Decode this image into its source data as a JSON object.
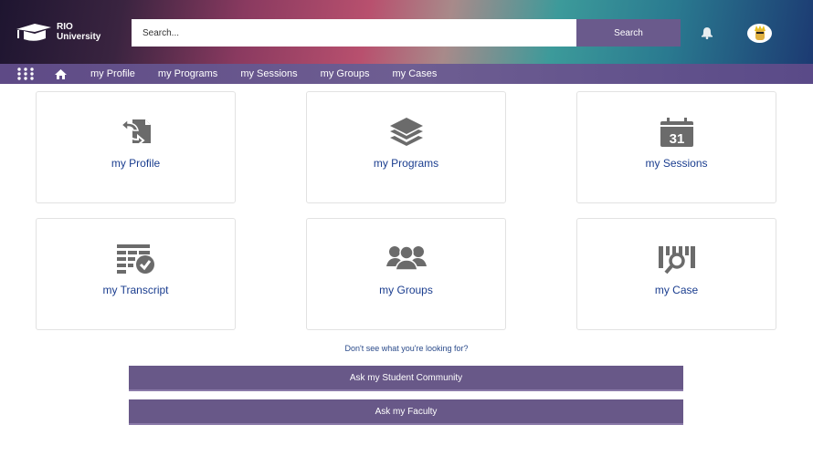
{
  "header": {
    "logo_line1": "RIO",
    "logo_line2": "University",
    "search_placeholder": "Search...",
    "search_button": "Search"
  },
  "nav": {
    "items": [
      "my Profile",
      "my Programs",
      "my Sessions",
      "my Groups",
      "my Cases"
    ]
  },
  "tiles": [
    {
      "label": "my Profile",
      "icon": "profile-swap-icon"
    },
    {
      "label": "my Programs",
      "icon": "layers-icon"
    },
    {
      "label": "my Sessions",
      "icon": "calendar-icon",
      "calendar_day": "31"
    },
    {
      "label": "my Transcript",
      "icon": "transcript-check-icon"
    },
    {
      "label": "my Groups",
      "icon": "groups-icon"
    },
    {
      "label": "my Case",
      "icon": "case-search-icon"
    }
  ],
  "help": {
    "question": "Don't see what you're looking for?",
    "ask_community": "Ask my Student Community",
    "ask_faculty": "Ask my Faculty"
  },
  "colors": {
    "accent": "#685888",
    "link": "#1a3d8f",
    "icon": "#6b6b6b"
  }
}
